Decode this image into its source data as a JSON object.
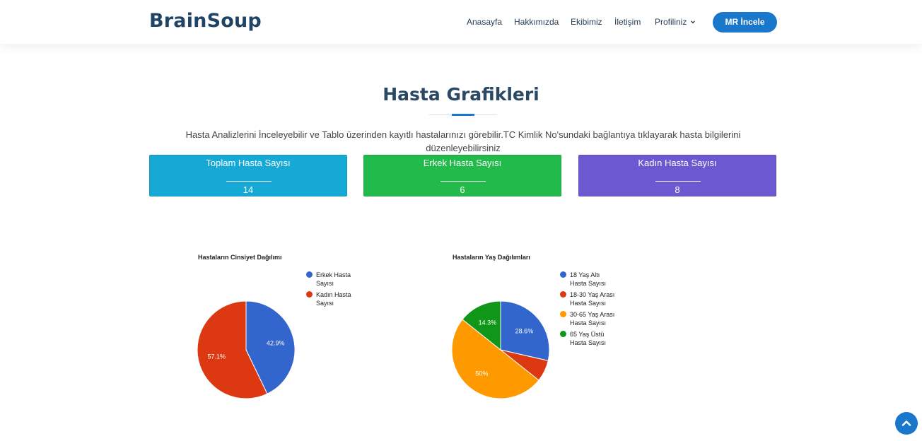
{
  "header": {
    "logo": "BrainSoup",
    "nav": [
      "Anasayfa",
      "Hakkımızda",
      "Ekibimiz",
      "İletişim"
    ],
    "profile_menu": "Profiliniz",
    "cta": "MR İncele"
  },
  "section": {
    "title": "Hasta Grafikleri",
    "description": "Hasta Analizlerini İnceleyebilir ve Tablo üzerinden kayıtlı hastalarınızı görebilir.TC Kimlik No'sundaki bağlantıya tıklayarak hasta bilgilerini düzenleyebilirsiniz"
  },
  "stats": [
    {
      "title": "Toplam Hasta Sayısı",
      "value": "14",
      "color": "#17a9d6"
    },
    {
      "title": "Erkek Hasta Sayısı",
      "value": "6",
      "color": "#22ba4a"
    },
    {
      "title": "Kadın Hasta Sayısı",
      "value": "8",
      "color": "#6c58d0"
    }
  ],
  "chart_data": [
    {
      "type": "pie",
      "title": "Hastaların Cinsiyet Dağılımı",
      "categories": [
        "Erkek Hasta Sayısı",
        "Kadın Hasta Sayısı"
      ],
      "values": [
        6,
        8
      ],
      "labels": [
        "42.9%",
        "57.1%"
      ],
      "colors": [
        "#3366cc",
        "#dc3912"
      ],
      "legend": "right"
    },
    {
      "type": "pie",
      "title": "Hastaların Yaş Dağılımları",
      "categories": [
        "18 Yaş Altı Hasta Sayısı",
        "18-30 Yaş Arası Hasta Sayısı",
        "30-65 Yaş Arası Hasta Sayısı",
        "65 Yaş Üstü Hasta Sayısı"
      ],
      "values": [
        4,
        1,
        7,
        2
      ],
      "labels": [
        "28.6%",
        "",
        "50%",
        "14.3%"
      ],
      "colors": [
        "#3366cc",
        "#dc3912",
        "#ff9900",
        "#109618"
      ],
      "legend": "right"
    }
  ]
}
